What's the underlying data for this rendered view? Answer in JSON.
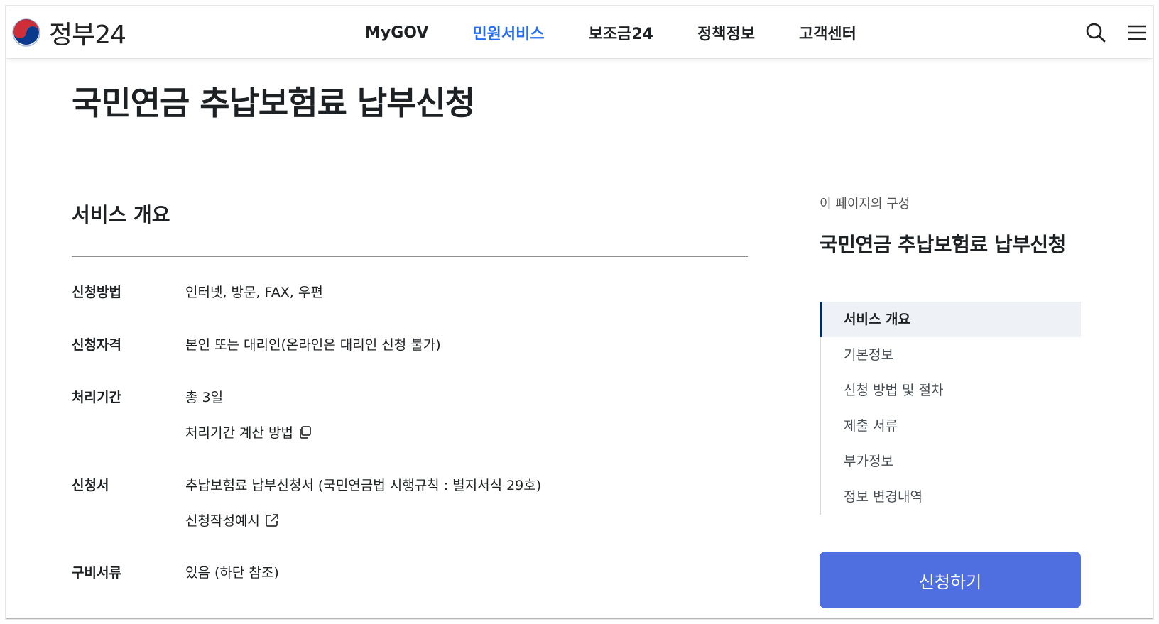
{
  "header": {
    "logo_text": "정부24",
    "nav": [
      "MyGOV",
      "민원서비스",
      "보조금24",
      "정책정보",
      "고객센터"
    ],
    "active_nav": "민원서비스"
  },
  "page": {
    "title": "국민연금 추납보험료 납부신청"
  },
  "overview": {
    "section_title": "서비스 개요",
    "rows": {
      "method_label": "신청방법",
      "method_value": "인터넷, 방문, FAX, 우편",
      "eligibility_label": "신청자격",
      "eligibility_value": "본인 또는 대리인(온라인은 대리인 신청 불가)",
      "period_label": "처리기간",
      "period_value": "총 3일",
      "period_link": "처리기간 계산 방법",
      "form_label": "신청서",
      "form_value": "추납보험료 납부신청서 (국민연금법 시행규칙 : 별지서식 29호)",
      "form_link": "신청작성예시",
      "docs_label": "구비서류",
      "docs_value": "있음 (하단 참조)"
    }
  },
  "toc": {
    "caption": "이 페이지의 구성",
    "title": "국민연금 추납보험료 납부신청",
    "items": [
      "서비스 개요",
      "기본정보",
      "신청 방법 및 절차",
      "제출 서류",
      "부가정보",
      "정보 변경내역"
    ],
    "active_item": "서비스 개요"
  },
  "apply_button_label": "신청하기",
  "colors": {
    "brand_blue": "#256ef4",
    "apply_button": "#4f6fe0",
    "toc_active_bar": "#052b57"
  }
}
